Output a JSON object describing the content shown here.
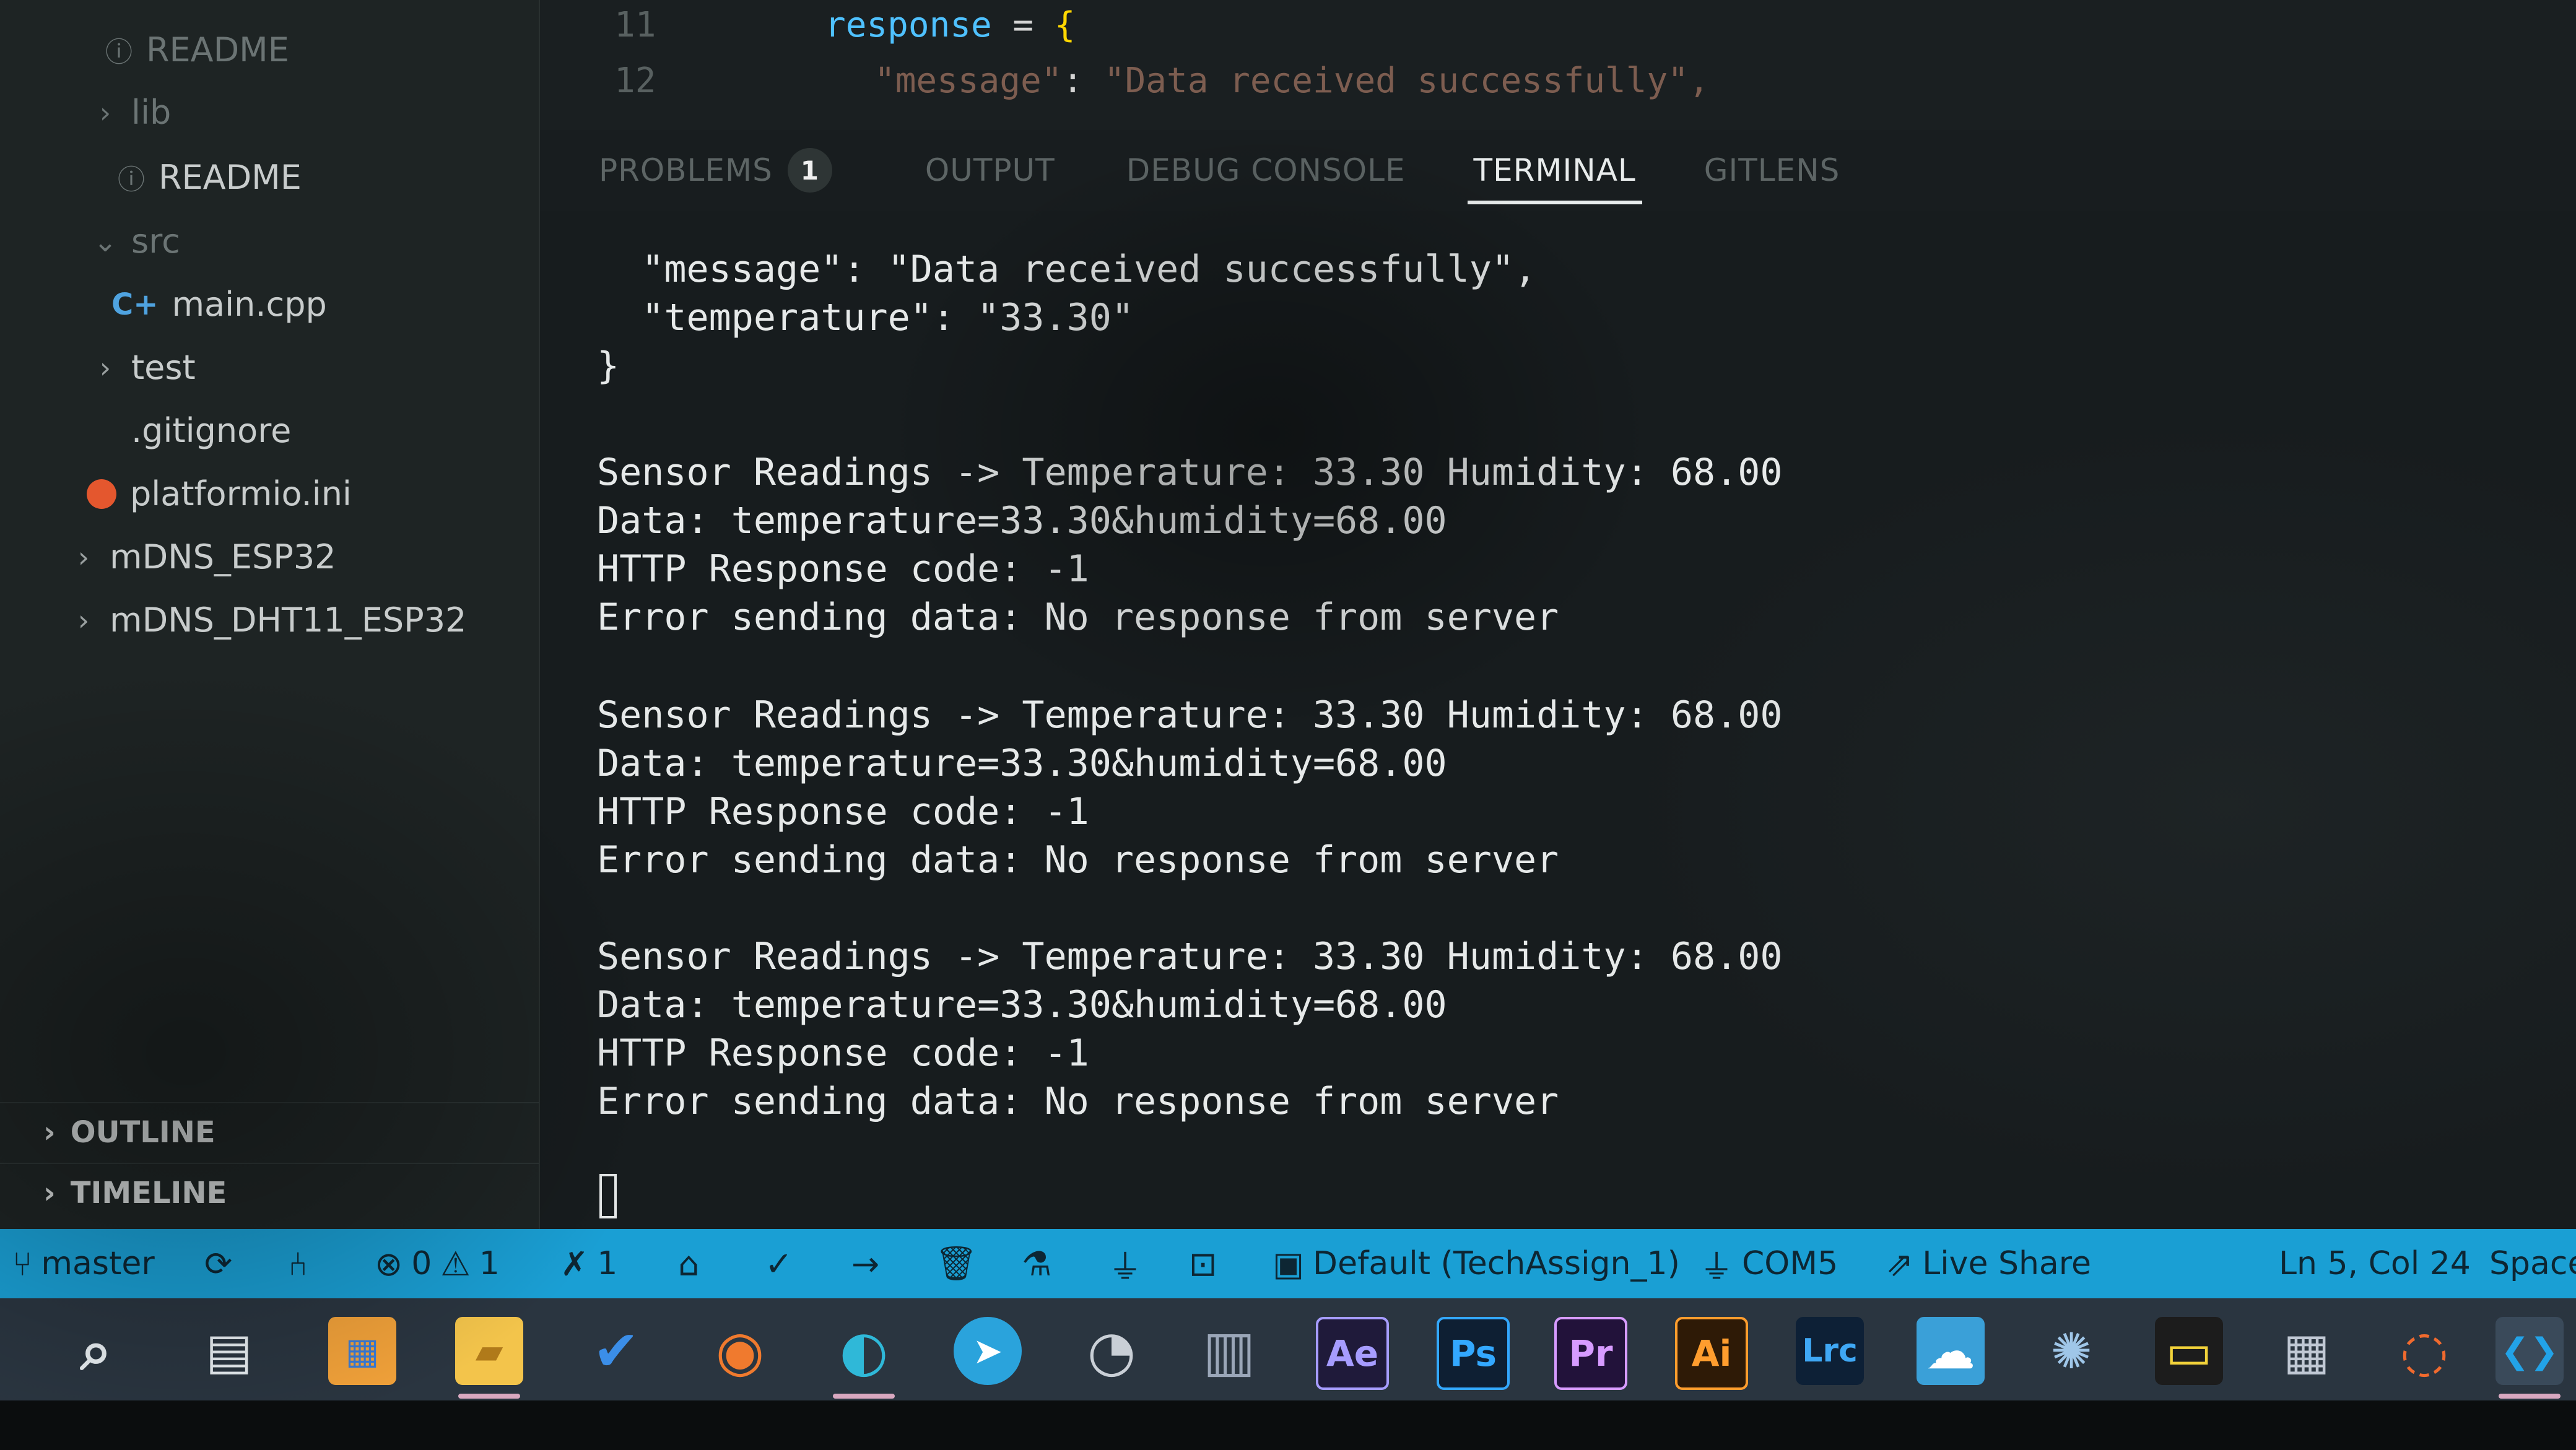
{
  "sidebar": {
    "items": [
      {
        "label": "README",
        "kind": "readme",
        "dim": true
      },
      {
        "label": "lib",
        "kind": "folder",
        "dim": true
      },
      {
        "label": "README",
        "kind": "readme",
        "dim": false
      },
      {
        "label": "src",
        "kind": "folder-open",
        "dim": true
      },
      {
        "label": "main.cpp",
        "kind": "cpp",
        "dim": false
      },
      {
        "label": "test",
        "kind": "folder",
        "dim": false
      },
      {
        "label": ".gitignore",
        "kind": "file",
        "dim": false
      },
      {
        "label": "platformio.ini",
        "kind": "pio",
        "dim": false
      },
      {
        "label": "mDNS_ESP32",
        "kind": "folder",
        "dim": false
      },
      {
        "label": "mDNS_DHT11_ESP32",
        "kind": "folder",
        "dim": false
      }
    ],
    "outline_label": "OUTLINE",
    "timeline_label": "TIMELINE"
  },
  "editor": {
    "lines": [
      {
        "num": "11",
        "var": "response",
        "op": " = ",
        "brace": "{"
      },
      {
        "num": "12",
        "key": "\"message\"",
        "sep": ": ",
        "val": "\"Data received successfully\","
      }
    ]
  },
  "panel": {
    "tabs": [
      {
        "label": "PROBLEMS",
        "badge": "1"
      },
      {
        "label": "OUTPUT"
      },
      {
        "label": "DEBUG CONSOLE"
      },
      {
        "label": "TERMINAL",
        "active": true
      },
      {
        "label": "GITLENS"
      }
    ]
  },
  "terminal": {
    "lines": [
      "  \"message\": \"Data received successfully\",",
      "  \"temperature\": \"33.30\"",
      "}",
      "",
      "Sensor Readings -> Temperature: 33.30 Humidity: 68.00",
      "Data: temperature=33.30&humidity=68.00",
      "HTTP Response code: -1",
      "Error sending data: No response from server",
      "",
      "Sensor Readings -> Temperature: 33.30 Humidity: 68.00",
      "Data: temperature=33.30&humidity=68.00",
      "HTTP Response code: -1",
      "Error sending data: No response from server",
      "",
      "Sensor Readings -> Temperature: 33.30 Humidity: 68.00",
      "Data: temperature=33.30&humidity=68.00",
      "HTTP Response code: -1",
      "Error sending data: No response from server"
    ]
  },
  "statusbar": {
    "branch": "master",
    "errors": "0",
    "warnings": "1",
    "pio_count": "1",
    "env": "Default (TechAssign_1)",
    "port": "COM5",
    "live_share": "Live Share",
    "position": "Ln 5, Col 24",
    "spaces": "Space",
    "bg_color": "#1a9fd4"
  },
  "taskbar": {
    "apps": [
      {
        "name": "search",
        "glyph": "⌕"
      },
      {
        "name": "task-view",
        "glyph": "▤"
      },
      {
        "name": "store",
        "glyph": "▦"
      },
      {
        "name": "file-explorer",
        "glyph": "▰"
      },
      {
        "name": "todo",
        "glyph": "✔"
      },
      {
        "name": "firefox",
        "glyph": "◉"
      },
      {
        "name": "edge",
        "glyph": "◐"
      },
      {
        "name": "telegram",
        "glyph": "➤"
      },
      {
        "name": "davinci",
        "glyph": "◔"
      },
      {
        "name": "winrar",
        "glyph": "▥"
      },
      {
        "name": "after-effects",
        "glyph": "Ae"
      },
      {
        "name": "photoshop",
        "glyph": "Ps"
      },
      {
        "name": "premiere",
        "glyph": "Pr"
      },
      {
        "name": "illustrator",
        "glyph": "Ai"
      },
      {
        "name": "lightroom-classic",
        "glyph": "Lrc"
      },
      {
        "name": "cloud-app",
        "glyph": "☁"
      },
      {
        "name": "atom-app",
        "glyph": "✺"
      },
      {
        "name": "terminal-app",
        "glyph": "▭"
      },
      {
        "name": "dashboard-app",
        "glyph": "▦"
      },
      {
        "name": "sync-app",
        "glyph": "◌"
      },
      {
        "name": "vscode",
        "glyph": "❮❯"
      }
    ]
  }
}
